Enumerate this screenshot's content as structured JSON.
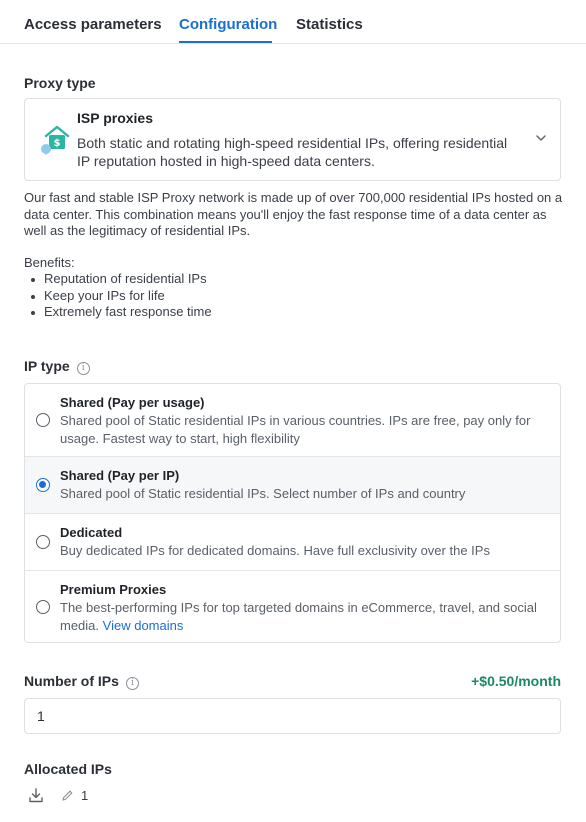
{
  "tabs": [
    {
      "label": "Access parameters",
      "active": false
    },
    {
      "label": "Configuration",
      "active": true
    },
    {
      "label": "Statistics",
      "active": false
    }
  ],
  "proxy_type": {
    "label": "Proxy type",
    "icon": "house-dollar-pin-icon",
    "title": "ISP proxies",
    "description": "Both static and rotating high-speed residential IPs, offering residential IP reputation hosted in high-speed data centers."
  },
  "description": "Our fast and stable ISP Proxy network is made up of over 700,000 residential IPs hosted on a data center. This combination means you'll enjoy the fast response time of a data center as well as the legitimacy of residential IPs.",
  "benefits": {
    "title": "Benefits:",
    "items": [
      "Reputation of residential IPs",
      "Keep your IPs for life",
      "Extremely fast response time"
    ]
  },
  "ip_type": {
    "label": "IP type",
    "options": [
      {
        "title": "Shared (Pay per usage)",
        "description": "Shared pool of Static residential IPs in various countries. IPs are free, pay only for usage. Fastest way to start, high flexibility",
        "selected": false
      },
      {
        "title": "Shared (Pay per IP)",
        "description": "Shared pool of Static residential IPs. Select number of IPs and country",
        "selected": true
      },
      {
        "title": "Dedicated",
        "description": "Buy dedicated IPs for dedicated domains. Have full exclusivity over the IPs",
        "selected": false
      },
      {
        "title": "Premium Proxies",
        "description": "The best-performing IPs for top targeted domains in eCommerce, travel, and social media.",
        "link": "View domains",
        "selected": false
      }
    ]
  },
  "number_of_ips": {
    "label": "Number of IPs",
    "price": "+$0.50/month",
    "value": "1"
  },
  "allocated_ips": {
    "label": "Allocated IPs",
    "count": "1"
  },
  "colors": {
    "accent": "#1a6fd1",
    "price": "#1b8a63",
    "icon_teal": "#2bb5a5"
  }
}
